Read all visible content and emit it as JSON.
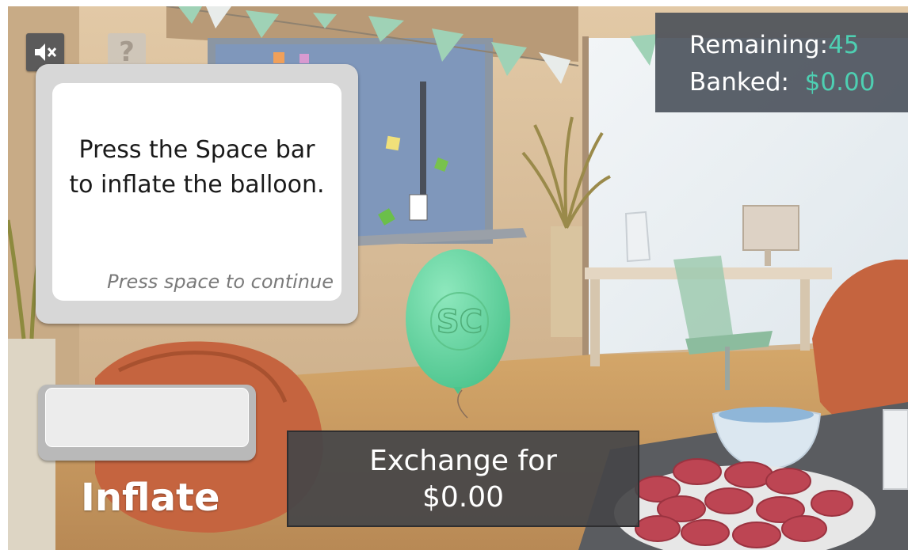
{
  "hud": {
    "remaining_label": "Remaining:",
    "remaining_value": "45",
    "banked_label": "Banked:",
    "banked_value": "$0.00"
  },
  "buttons": {
    "mute_icon": "speaker-muted-icon",
    "help_label": "?"
  },
  "instruction": {
    "text": "Press the Space bar to inflate the balloon.",
    "hint": "Press space to continue"
  },
  "inflate": {
    "label": "Inflate"
  },
  "exchange": {
    "line1": "Exchange for",
    "line2": "$0.00"
  },
  "balloon": {
    "logo": "SC",
    "color": "#6dd9a4"
  },
  "colors": {
    "accent": "#4ecfb2",
    "panel": "#464c56"
  }
}
